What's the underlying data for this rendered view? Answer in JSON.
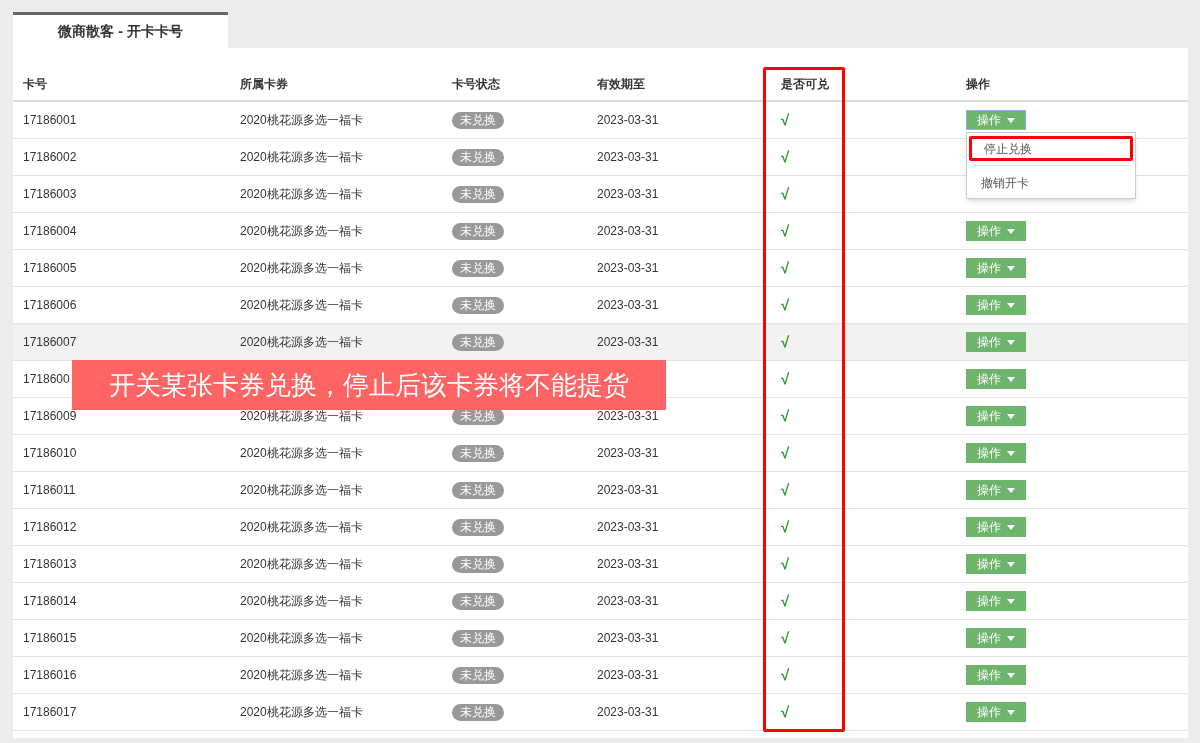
{
  "tab": {
    "label": "微商散客 - 开卡卡号",
    "selected": true
  },
  "columns": [
    {
      "label": "卡号"
    },
    {
      "label": "所属卡券"
    },
    {
      "label": "卡号状态"
    },
    {
      "label": "有效期至"
    },
    {
      "label": "是否可兑"
    },
    {
      "label": "操作"
    }
  ],
  "rows": [
    {
      "card_no": "17186001",
      "coupon": "2020桃花源多选一福卡",
      "status": "未兑换",
      "expiry": "2023-03-31",
      "redeemable": "√",
      "action": "操作",
      "hovered": false,
      "menu": {
        "items": [
          {
            "label": "停止兑换",
            "highlighted": true
          },
          {
            "label": "撤销开卡",
            "highlighted": false
          }
        ]
      }
    },
    {
      "card_no": "17186002",
      "coupon": "2020桃花源多选一福卡",
      "status": "未兑换",
      "expiry": "2023-03-31",
      "redeemable": "√",
      "hovered": false
    },
    {
      "card_no": "17186003",
      "coupon": "2020桃花源多选一福卡",
      "status": "未兑换",
      "expiry": "2023-03-31",
      "redeemable": "√",
      "hovered": false
    },
    {
      "card_no": "17186004",
      "coupon": "2020桃花源多选一福卡",
      "status": "未兑换",
      "expiry": "2023-03-31",
      "redeemable": "√",
      "action": "操作",
      "hovered": false
    },
    {
      "card_no": "17186005",
      "coupon": "2020桃花源多选一福卡",
      "status": "未兑换",
      "expiry": "2023-03-31",
      "redeemable": "√",
      "action": "操作",
      "hovered": false
    },
    {
      "card_no": "17186006",
      "coupon": "2020桃花源多选一福卡",
      "status": "未兑换",
      "expiry": "2023-03-31",
      "redeemable": "√",
      "action": "操作",
      "hovered": false
    },
    {
      "card_no": "17186007",
      "coupon": "2020桃花源多选一福卡",
      "status": "未兑换",
      "expiry": "2023-03-31",
      "redeemable": "√",
      "action": "操作",
      "hovered": true
    },
    {
      "card_no": "1718600",
      "redeemable": "√",
      "action": "操作",
      "hovered": false
    },
    {
      "card_no": "17186009",
      "coupon": "2020桃花源多选一福卡",
      "status": "未兑换",
      "expiry": "2023-03-31",
      "redeemable": "√",
      "action": "操作",
      "hovered": false
    },
    {
      "card_no": "17186010",
      "coupon": "2020桃花源多选一福卡",
      "status": "未兑换",
      "expiry": "2023-03-31",
      "redeemable": "√",
      "action": "操作",
      "hovered": false
    },
    {
      "card_no": "17186011",
      "coupon": "2020桃花源多选一福卡",
      "status": "未兑换",
      "expiry": "2023-03-31",
      "redeemable": "√",
      "action": "操作",
      "hovered": false
    },
    {
      "card_no": "17186012",
      "coupon": "2020桃花源多选一福卡",
      "status": "未兑换",
      "expiry": "2023-03-31",
      "redeemable": "√",
      "action": "操作",
      "hovered": false
    },
    {
      "card_no": "17186013",
      "coupon": "2020桃花源多选一福卡",
      "status": "未兑换",
      "expiry": "2023-03-31",
      "redeemable": "√",
      "action": "操作",
      "hovered": false
    },
    {
      "card_no": "17186014",
      "coupon": "2020桃花源多选一福卡",
      "status": "未兑换",
      "expiry": "2023-03-31",
      "redeemable": "√",
      "action": "操作",
      "hovered": false
    },
    {
      "card_no": "17186015",
      "coupon": "2020桃花源多选一福卡",
      "status": "未兑换",
      "expiry": "2023-03-31",
      "redeemable": "√",
      "action": "操作",
      "hovered": false
    },
    {
      "card_no": "17186016",
      "coupon": "2020桃花源多选一福卡",
      "status": "未兑换",
      "expiry": "2023-03-31",
      "redeemable": "√",
      "action": "操作",
      "hovered": false
    },
    {
      "card_no": "17186017",
      "coupon": "2020桃花源多选一福卡",
      "status": "未兑换",
      "expiry": "2023-03-31",
      "redeemable": "√",
      "action": "操作",
      "hovered": false
    }
  ],
  "annotation": {
    "text": "开关某张卡券兑换，停止后该卡券将不能提货"
  }
}
